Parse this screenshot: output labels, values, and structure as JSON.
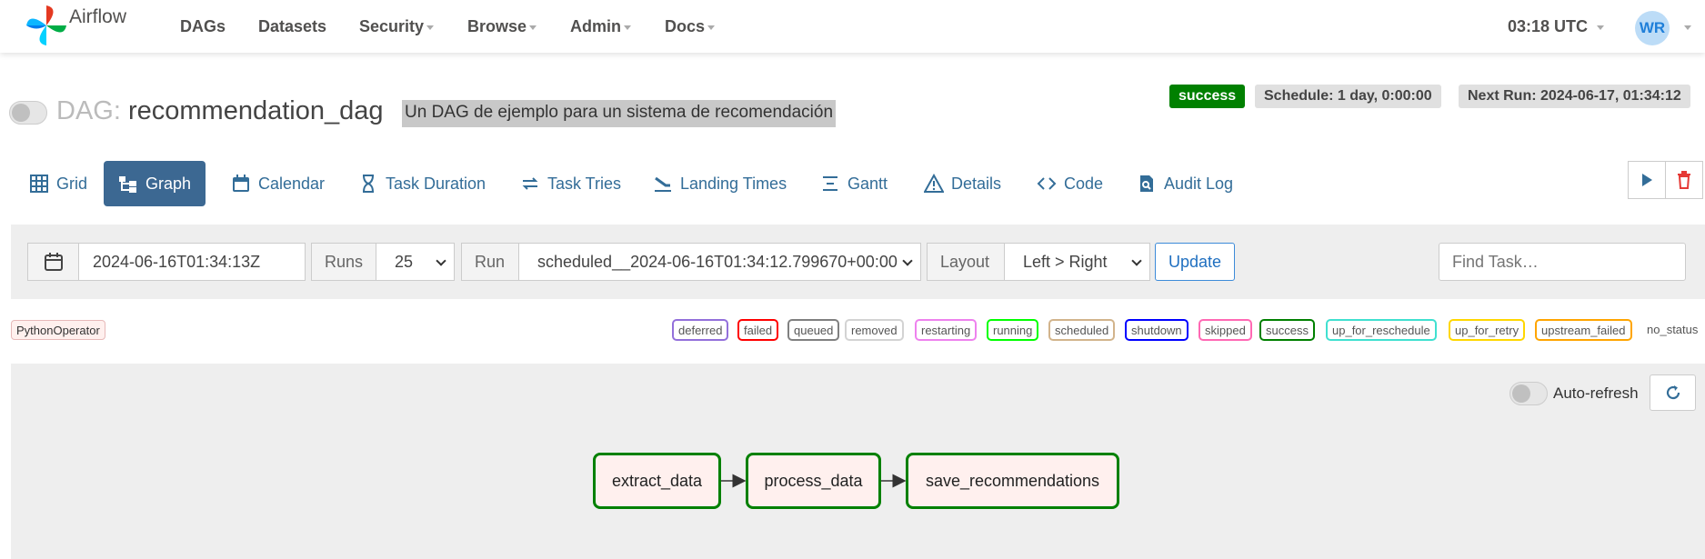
{
  "brand": {
    "name": "Airflow"
  },
  "nav": {
    "items": [
      {
        "label": "DAGs",
        "dropdown": false
      },
      {
        "label": "Datasets",
        "dropdown": false
      },
      {
        "label": "Security",
        "dropdown": true
      },
      {
        "label": "Browse",
        "dropdown": true
      },
      {
        "label": "Admin",
        "dropdown": true
      },
      {
        "label": "Docs",
        "dropdown": true
      }
    ],
    "time": "03:18 UTC",
    "user_initials": "WR"
  },
  "dag": {
    "prefix": "DAG:",
    "id": "recommendation_dag",
    "description": "Un DAG de ejemplo para un sistema de recomendación",
    "state": "success",
    "schedule": "Schedule: 1 day, 0:00:00",
    "next_run": "Next Run: 2024-06-17, 01:34:12"
  },
  "tabs": [
    {
      "label": "Grid",
      "icon": "grid-icon"
    },
    {
      "label": "Graph",
      "icon": "graph-icon",
      "active": true
    },
    {
      "label": "Calendar",
      "icon": "calendar-icon"
    },
    {
      "label": "Task Duration",
      "icon": "hourglass-icon"
    },
    {
      "label": "Task Tries",
      "icon": "retry-icon"
    },
    {
      "label": "Landing Times",
      "icon": "landing-icon"
    },
    {
      "label": "Gantt",
      "icon": "gantt-icon"
    },
    {
      "label": "Details",
      "icon": "warning-icon"
    },
    {
      "label": "Code",
      "icon": "code-icon"
    },
    {
      "label": "Audit Log",
      "icon": "audit-icon"
    }
  ],
  "controls": {
    "date": "2024-06-16T01:34:13Z",
    "runs_label": "Runs",
    "runs_value": "25",
    "run_label": "Run",
    "run_value": "scheduled__2024-06-16T01:34:12.799670+00:00",
    "layout_label": "Layout",
    "layout_value": "Left > Right",
    "update_label": "Update",
    "find_placeholder": "Find Task…"
  },
  "legend": {
    "operator": "PythonOperator",
    "states": [
      {
        "label": "deferred",
        "color": "#9370db"
      },
      {
        "label": "failed",
        "color": "#ff0000"
      },
      {
        "label": "queued",
        "color": "#808080"
      },
      {
        "label": "removed",
        "color": "#d3d3d3"
      },
      {
        "label": "restarting",
        "color": "#ee82ee"
      },
      {
        "label": "running",
        "color": "#00ff00"
      },
      {
        "label": "scheduled",
        "color": "#d2b48c"
      },
      {
        "label": "shutdown",
        "color": "#0000ff"
      },
      {
        "label": "skipped",
        "color": "#ff69b4"
      },
      {
        "label": "success",
        "color": "#008000"
      },
      {
        "label": "up_for_reschedule",
        "color": "#40e0d0"
      },
      {
        "label": "up_for_retry",
        "color": "#ffd700"
      },
      {
        "label": "upstream_failed",
        "color": "#ffa500"
      }
    ],
    "no_status": "no_status"
  },
  "graph": {
    "auto_refresh_label": "Auto-refresh",
    "tasks": [
      {
        "id": "extract_data",
        "state": "success"
      },
      {
        "id": "process_data",
        "state": "success"
      },
      {
        "id": "save_recommendations",
        "state": "success"
      }
    ]
  },
  "colors": {
    "accent": "#3c6892",
    "tab_text": "#336d98",
    "success": "#008000",
    "node_fill": "#fff0ee"
  }
}
